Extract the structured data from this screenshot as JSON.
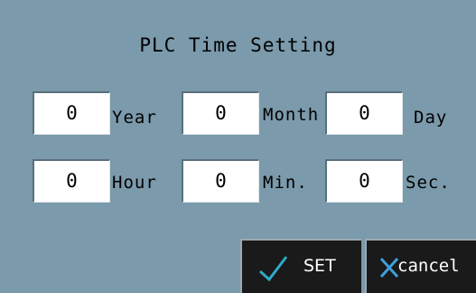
{
  "title": "PLC Time Setting",
  "fields": {
    "year": {
      "value": "0",
      "label": "Year"
    },
    "month": {
      "value": "0",
      "label": "Month"
    },
    "day": {
      "value": "0",
      "label": "Day"
    },
    "hour": {
      "value": "0",
      "label": "Hour"
    },
    "min": {
      "value": "0",
      "label": "Min."
    },
    "sec": {
      "value": "0",
      "label": "Sec."
    }
  },
  "buttons": {
    "set_label": "SET",
    "cancel_label": "cancel",
    "set_icon": "checkmark-icon",
    "cancel_icon": "x-icon"
  },
  "colors": {
    "background": "#7b9aab",
    "button": "#1a1a1a",
    "check": "#2fa9c9",
    "x": "#3f9fdc"
  }
}
